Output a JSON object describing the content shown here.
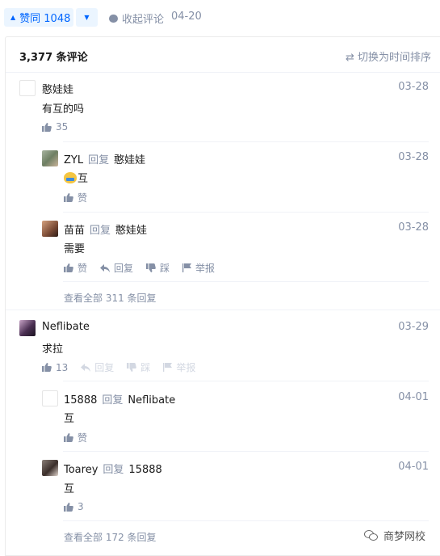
{
  "topbar": {
    "upvote_label": "赞同 1048",
    "collapse_label": "收起评论",
    "date": "04-20"
  },
  "header": {
    "count_label": "3,377 条评论",
    "sort_label": "切换为时间排序"
  },
  "comments": [
    {
      "author": "憨娃娃",
      "date": "03-28",
      "content": "有互的吗",
      "likes": "35",
      "replies": [
        {
          "author": "ZYL",
          "reply_word": "回复",
          "reply_to": "憨娃娃",
          "date": "03-28",
          "content": "互",
          "like_label": "赞"
        },
        {
          "author": "苗苗",
          "reply_word": "回复",
          "reply_to": "憨娃娃",
          "date": "03-28",
          "content": "需要",
          "like_label": "赞",
          "reply_label": "回复",
          "dislike_label": "踩",
          "report_label": "举报"
        }
      ],
      "view_all": "查看全部 311 条回复"
    },
    {
      "author": "Neflibate",
      "date": "03-29",
      "content": "求拉",
      "likes": "13",
      "reply_label": "回复",
      "dislike_label": "踩",
      "report_label": "举报",
      "replies": [
        {
          "author": "15888",
          "reply_word": "回复",
          "reply_to": "Neflibate",
          "date": "04-01",
          "content": "互",
          "like_label": "赞"
        },
        {
          "author": "Toarey",
          "reply_word": "回复",
          "reply_to": "15888",
          "date": "04-01",
          "content": "互",
          "likes": "3"
        }
      ],
      "view_all": "查看全部 172 条回复"
    }
  ],
  "watermark": "商梦网校",
  "colors": {
    "accent": "#0066ff",
    "muted": "#8590a6",
    "accent_bg": "#ebf5ff"
  }
}
